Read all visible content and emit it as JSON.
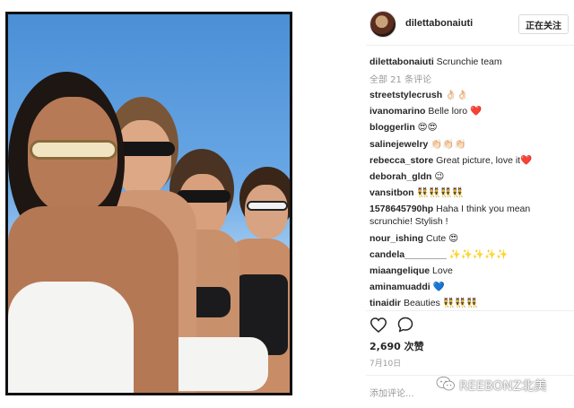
{
  "post": {
    "username": "dilettabonaiuti",
    "follow_label": "正在关注",
    "caption_user": "dilettabonaiuti",
    "caption_text": "Scrunchie team",
    "all_comments": "全部 21 条评论",
    "likes": "2,690 次赞",
    "date": "7月10日",
    "add_comment_placeholder": "添加评论..."
  },
  "comments": [
    {
      "user": "streetstylecrush",
      "text": "👌🏻👌🏻"
    },
    {
      "user": "ivanomarino",
      "text": "Belle loro ❤️"
    },
    {
      "user": "bloggerlin",
      "text": "😍😍"
    },
    {
      "user": "salinejewelry",
      "text": "👏🏻👏🏻👏🏻"
    },
    {
      "user": "rebecca_store",
      "text": "Great picture, love it❤️"
    },
    {
      "user": "deborah_gldn",
      "text": "😉"
    },
    {
      "user": "vansitbon",
      "text": "👯👯👯👯"
    },
    {
      "user": "1578645790hp",
      "text": "Haha I think you mean scrunchie! Stylish !"
    },
    {
      "user": "nour_ishing",
      "text": "Cute 😍"
    },
    {
      "user": "candela________",
      "text": "✨✨✨✨✨"
    },
    {
      "user": "miaangelique",
      "text": "Love"
    },
    {
      "user": "aminamuaddi",
      "text": "💙"
    },
    {
      "user": "tinaidir",
      "text": "Beauties 👯👯👯"
    }
  ],
  "icons": {
    "like": "heart-outline-icon",
    "comment": "speech-bubble-icon",
    "watermark": "wechat-logo-icon"
  },
  "watermark": {
    "text": "REEBONZ北美"
  },
  "colors": {
    "text": "#262626",
    "muted": "#999999",
    "heart": "#ed4956",
    "frame": "#111111"
  }
}
